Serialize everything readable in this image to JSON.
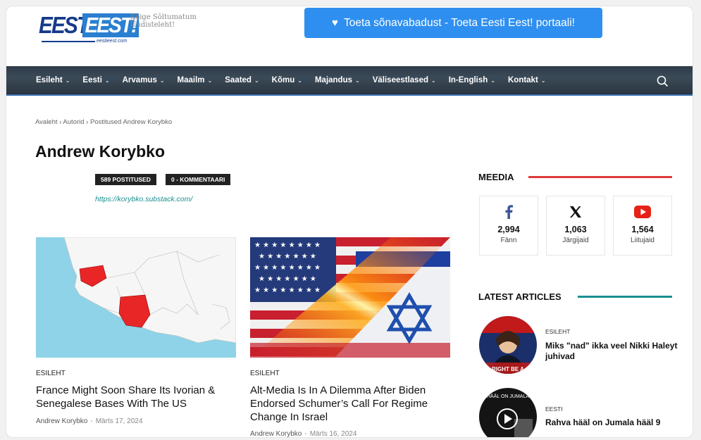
{
  "header": {
    "logo_part1": "EESTi",
    "logo_part2": "EEST!",
    "logo_tagline": "Kõige Sõltumatum Uudisteleht!",
    "logo_url": "eestieest.com",
    "donate_label": "Toeta sõnavabadust - Toeta Eesti Eest! portaali!"
  },
  "nav": {
    "items": [
      {
        "label": "Esileht"
      },
      {
        "label": "Eesti"
      },
      {
        "label": "Arvamus"
      },
      {
        "label": "Maailm"
      },
      {
        "label": "Saated"
      },
      {
        "label": "Kõmu"
      },
      {
        "label": "Majandus"
      },
      {
        "label": "Väliseestlased"
      },
      {
        "label": "In-English"
      },
      {
        "label": "Kontakt"
      }
    ]
  },
  "breadcrumb": "Avaleht › Autorid › Postitused Andrew Korybko",
  "author": {
    "name": "Andrew Korybko",
    "posts_badge": "589 POSTITUSED",
    "comments_badge": "0 - KOMMENTAARI",
    "link": "https://korybko.substack.com/"
  },
  "posts": [
    {
      "category": "ESILEHT",
      "title": "France Might Soon Share Its Ivorian & Senegalese Bases With The US",
      "author": "Andrew Korybko",
      "date": "Märts 17, 2024"
    },
    {
      "category": "ESILEHT",
      "title": "Alt-Media Is In A Dilemma After Biden Endorsed Schumer’s Call For Regime Change In Israel",
      "author": "Andrew Korybko",
      "date": "Märts 16, 2024"
    }
  ],
  "sidebar": {
    "media_heading": "MEEDIA",
    "media_accent": "#e03a3a",
    "social": [
      {
        "icon": "facebook-icon",
        "count": "2,994",
        "label": "Fänn"
      },
      {
        "icon": "x-icon",
        "count": "1,063",
        "label": "Järgijaid"
      },
      {
        "icon": "youtube-icon",
        "count": "1,564",
        "label": "Liitujaid"
      }
    ],
    "latest_heading": "LATEST ARTICLES",
    "latest_accent": "#1a8f8f",
    "articles": [
      {
        "category": "ESILEHT",
        "title": "Miks \"nad\" ikka veel Nikki Haleyt juhivad",
        "thumb_caption": "RIGHT BE A"
      },
      {
        "category": "EESTI",
        "title": "Rahva hääl on Jumala hääl 9",
        "thumb_caption": "HÄÄL ON JUMALA"
      }
    ]
  }
}
